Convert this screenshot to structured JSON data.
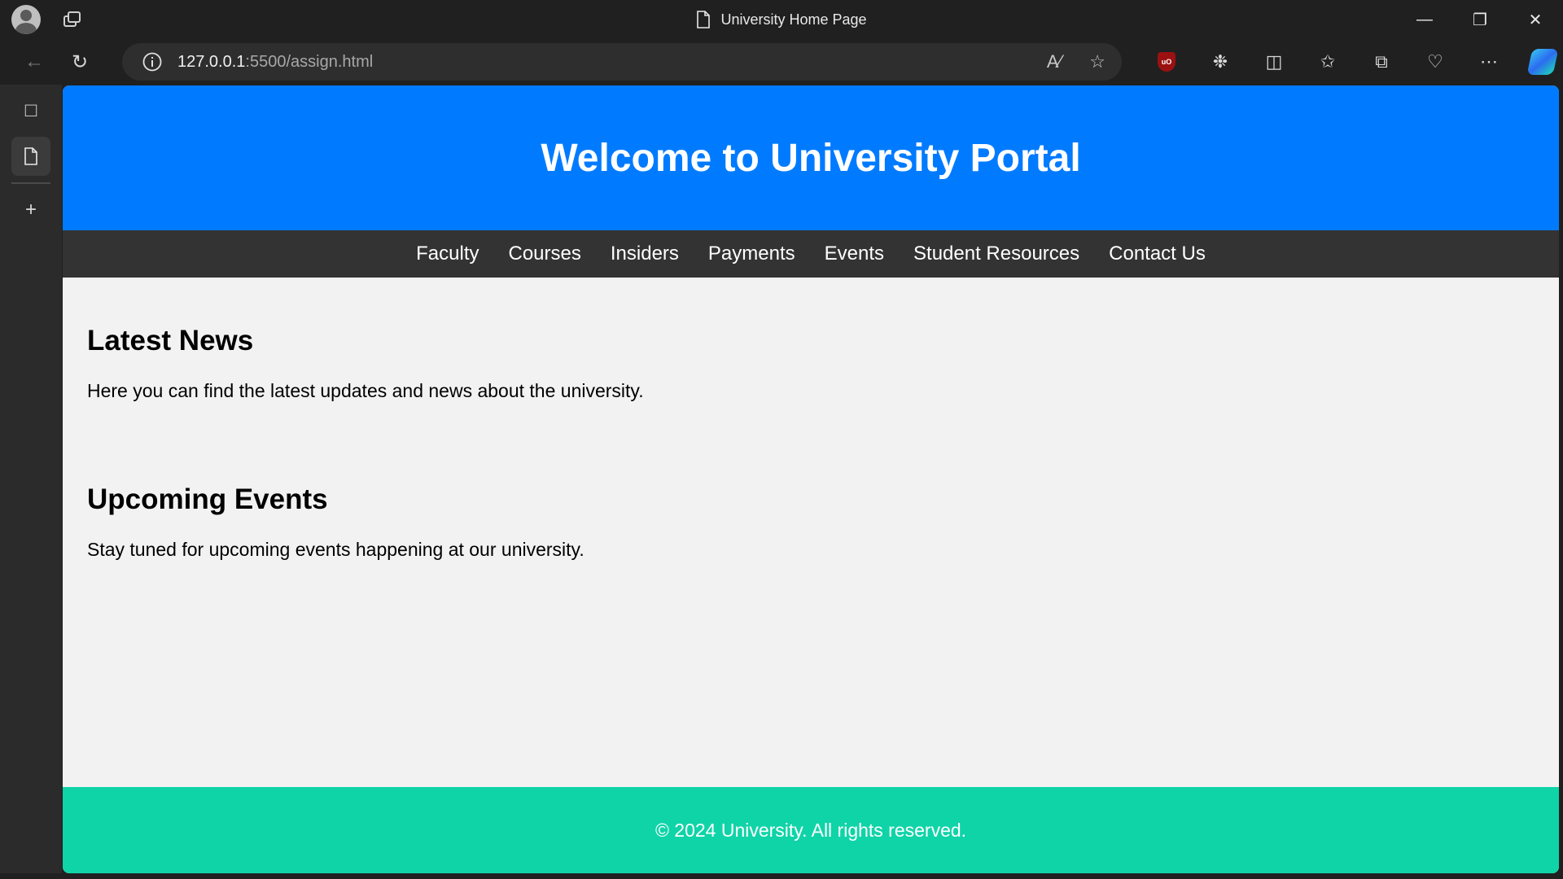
{
  "browser": {
    "window_title": "University Home Page",
    "window_controls": [
      "minimize",
      "restore",
      "close"
    ],
    "url_host": "127.0.0.1",
    "url_path": ":5500/assign.html"
  },
  "page": {
    "header_title": "Welcome to University Portal",
    "nav": [
      "Faculty",
      "Courses",
      "Insiders",
      "Payments",
      "Events",
      "Student Resources",
      "Contact Us"
    ],
    "sections": [
      {
        "title": "Latest News",
        "text": "Here you can find the latest updates and news about the university."
      },
      {
        "title": "Upcoming Events",
        "text": "Stay tuned for upcoming events happening at our university."
      }
    ],
    "footer": "© 2024 University. All rights reserved."
  },
  "colors": {
    "header_bg": "#007bff",
    "nav_bg": "#333333",
    "footer_bg": "#0fd4a8",
    "page_bg": "#f2f2f2"
  }
}
